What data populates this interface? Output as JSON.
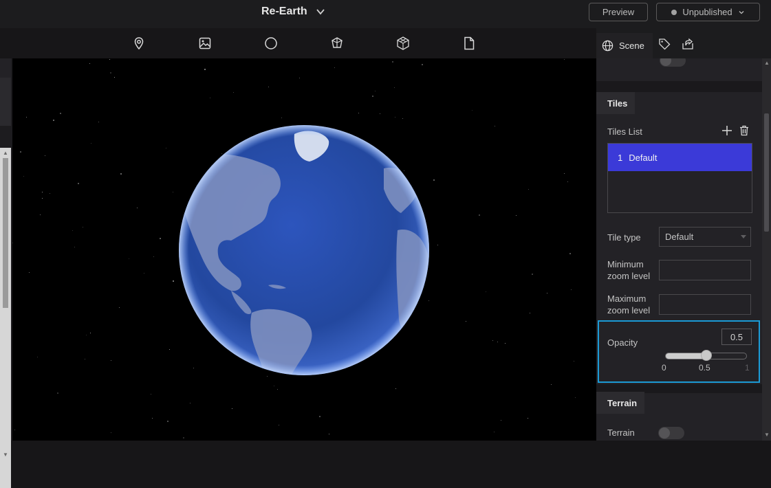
{
  "header": {
    "title": "Re-Earth",
    "preview_label": "Preview",
    "publish_label": "Unpublished"
  },
  "toolbar": {
    "tools": [
      "map-pin-icon",
      "image-icon",
      "circle-icon",
      "box-icon",
      "resource-icon",
      "file-icon"
    ]
  },
  "right_panel": {
    "tabs": {
      "scene_label": "Scene",
      "icons": [
        "globe-icon",
        "tag-icon",
        "export-icon"
      ]
    },
    "tiles_section": {
      "title": "Tiles",
      "list_label": "Tiles List",
      "items": [
        {
          "index": "1",
          "name": "Default"
        }
      ],
      "tile_type_label": "Tile type",
      "tile_type_value": "Default",
      "min_zoom_label_1": "Minimum",
      "min_zoom_label_2": "zoom level",
      "max_zoom_label_1": "Maximum",
      "max_zoom_label_2": "zoom level",
      "opacity_label": "Opacity",
      "opacity_value": "0.5",
      "opacity_fraction": 0.5,
      "opacity_marks": [
        "0",
        "0.5",
        "1"
      ]
    },
    "terrain_section": {
      "title": "Terrain",
      "terrain_label": "Terrain"
    }
  },
  "colors": {
    "accent": "#3b3ad8",
    "focus_outline": "#1b9bd6",
    "ocean": "#2c52b5"
  }
}
